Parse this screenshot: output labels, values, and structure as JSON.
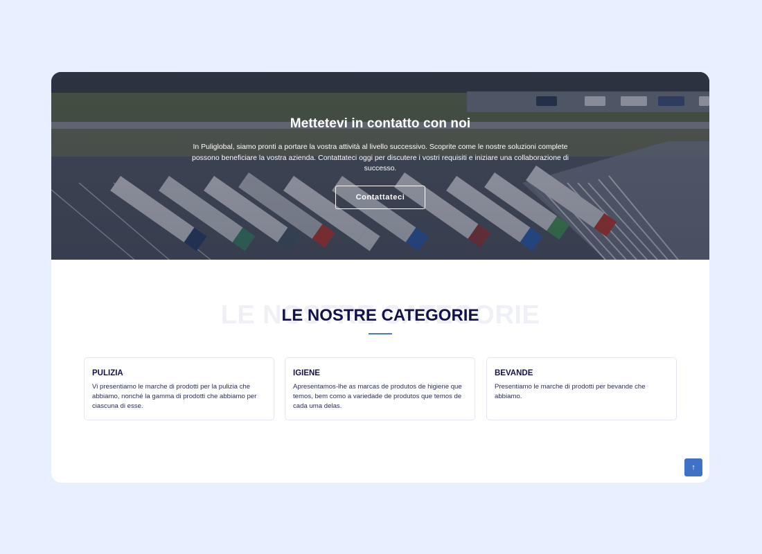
{
  "hero": {
    "title": "Mettetevi in contatto con noi",
    "text": "In Puliglobal, siamo pronti a portare la vostra attività al livello successivo. Scoprite come le nostre soluzioni complete possono beneficiare la vostra azienda. Contattateci oggi per discutere i vostri requisiti e iniziare una collaborazione di successo.",
    "button_label": "Contattateci"
  },
  "categories_section": {
    "background_title": "LE NOSTRE CATEGORIE",
    "title": "LE NOSTRE CATEGORIE",
    "items": [
      {
        "title": "PULIZIA",
        "description": "Vi presentiamo le marche di prodotti per la pulizia che abbiamo, nonché la gamma di prodotti che abbiamo per ciascuna di esse."
      },
      {
        "title": "IGIENE",
        "description": "Apresentamos-lhe as marcas de produtos de higiene que temos, bem como a variedade de produtos que temos de cada uma delas."
      },
      {
        "title": "BEVANDE",
        "description": "Presentiamo le marche di prodotti per bevande che abbiamo."
      }
    ]
  },
  "scroll_top": {
    "icon": "arrow-up-icon",
    "glyph": "↑"
  },
  "colors": {
    "page_background": "#e8efff",
    "heading": "#14124a",
    "accent": "#4a78c9",
    "button": "#3f72c6"
  }
}
